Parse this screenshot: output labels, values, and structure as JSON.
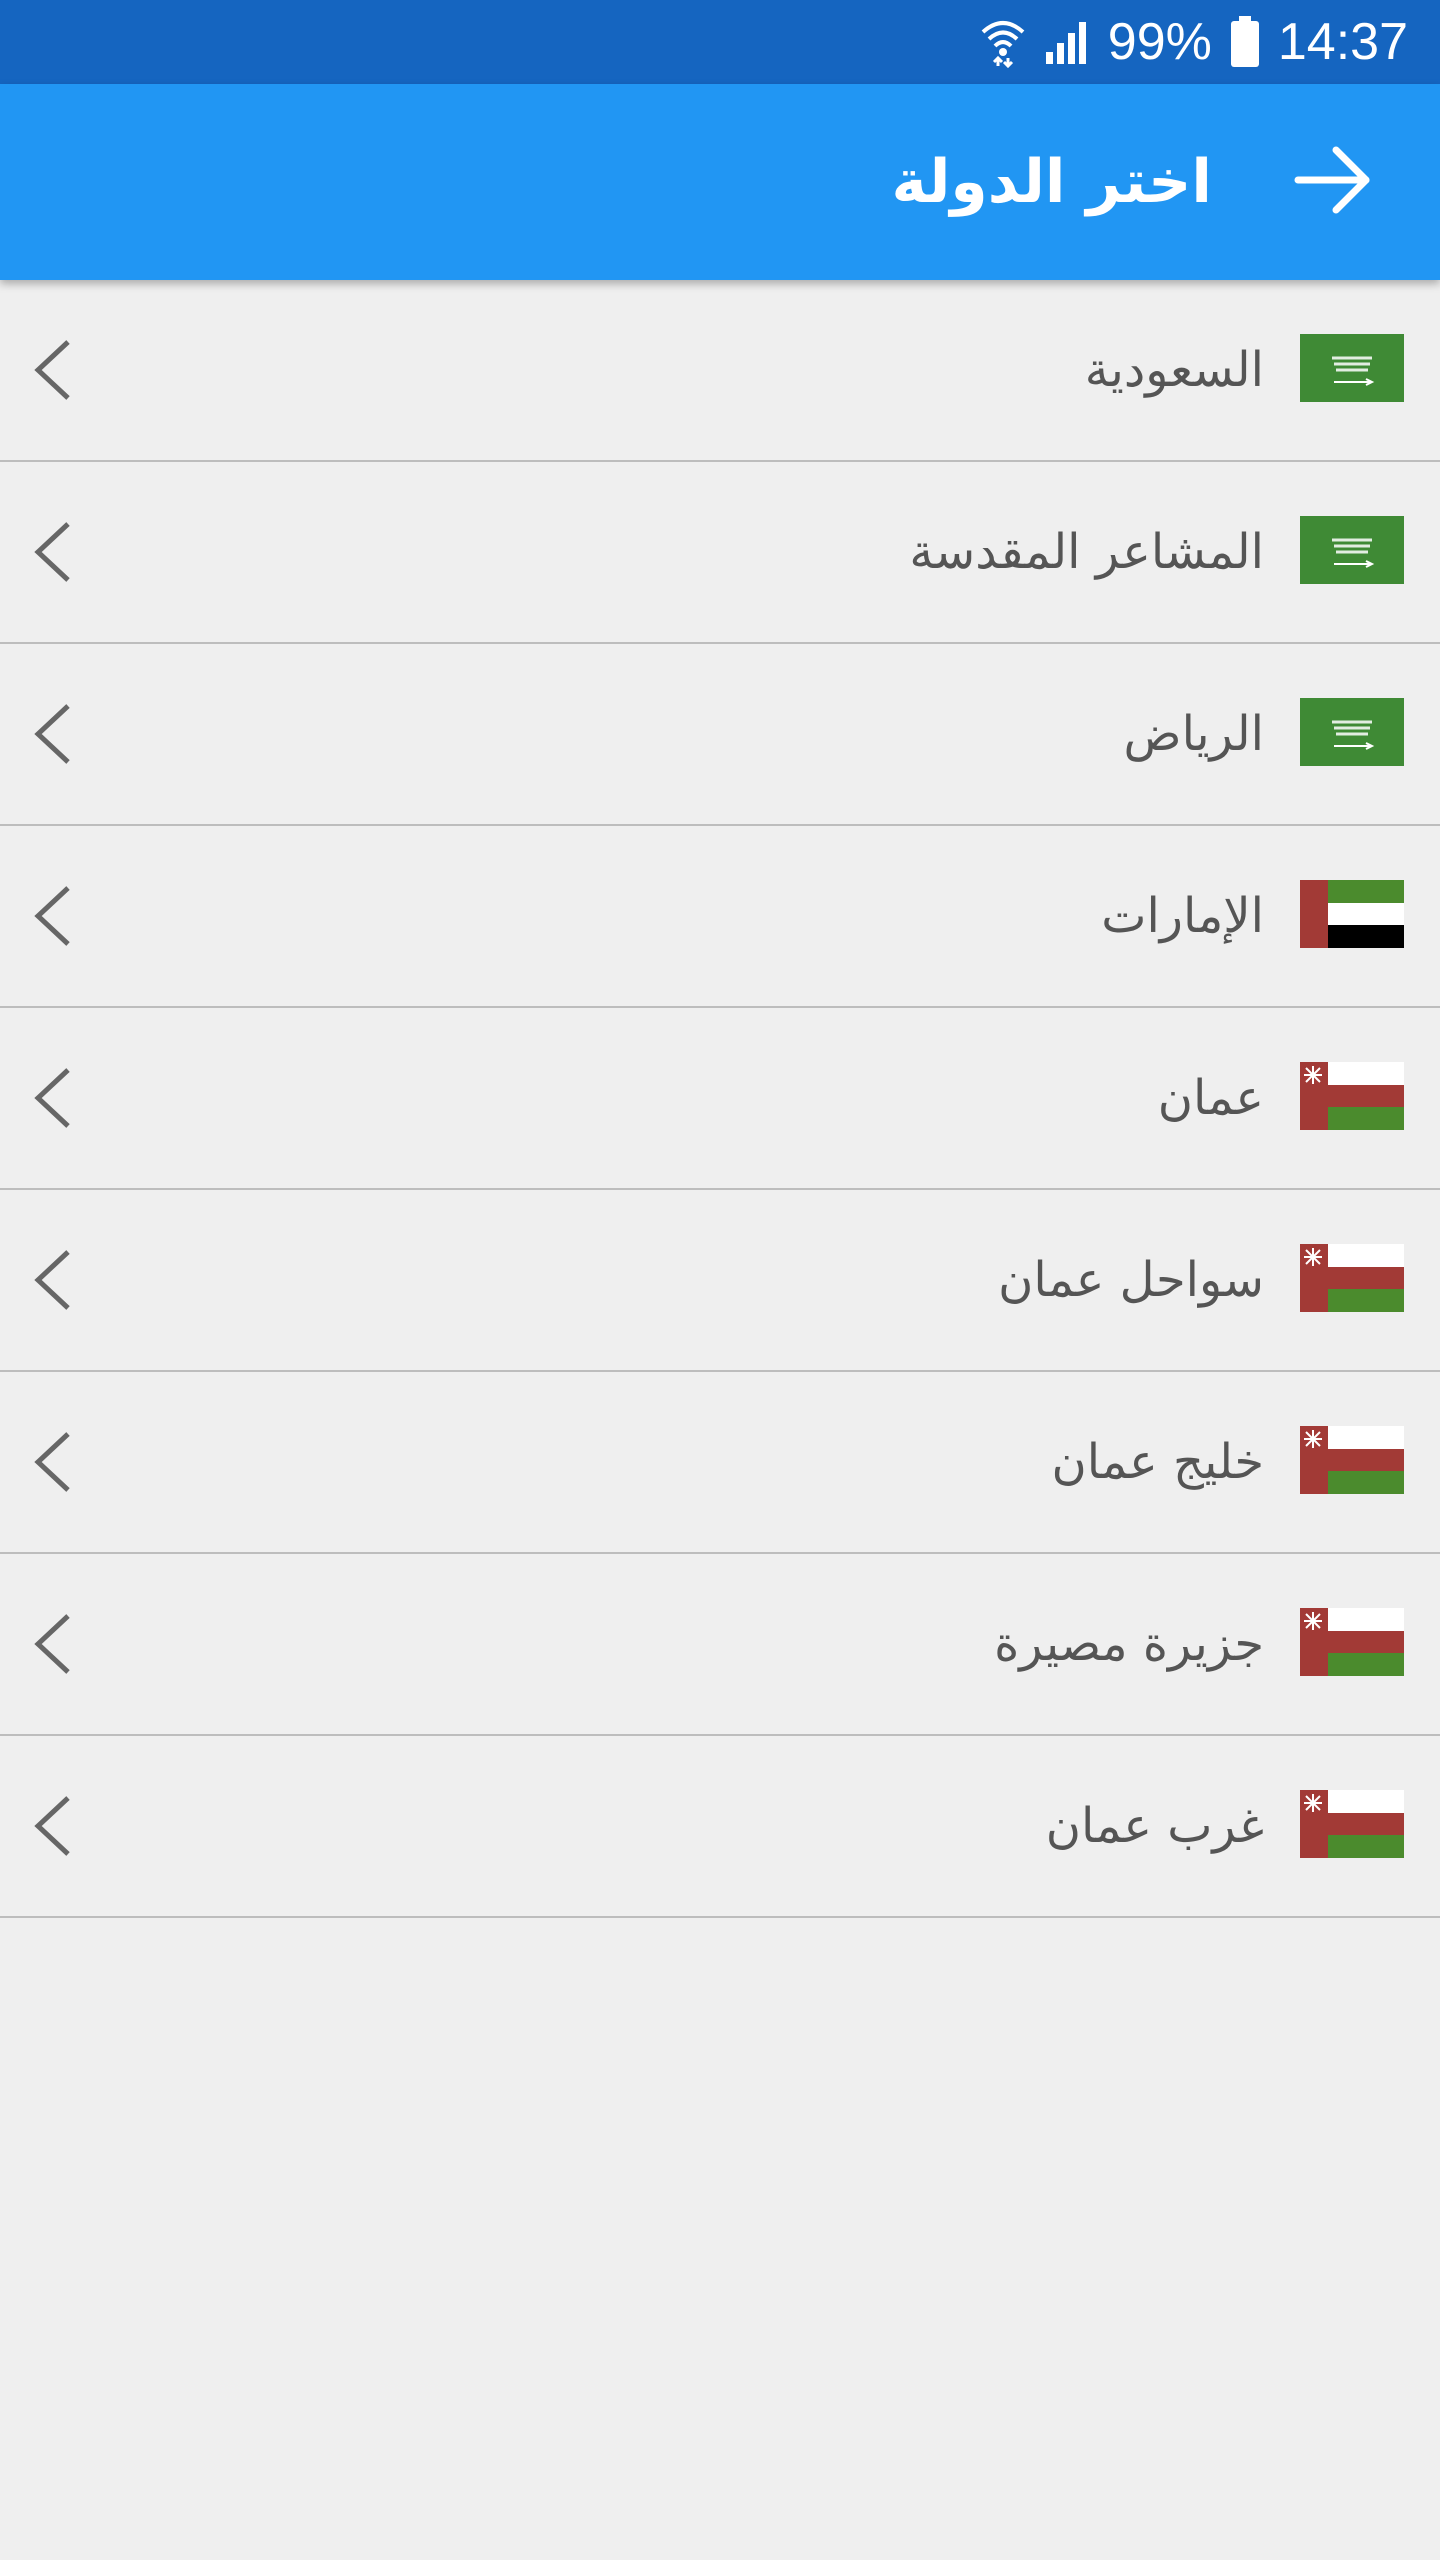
{
  "status_bar": {
    "battery_text": "99%",
    "time": "14:37",
    "icons": [
      "wifi-icon",
      "signal-icon",
      "battery-icon"
    ]
  },
  "app_bar": {
    "title": "اختر الدولة",
    "back_icon": "arrow-forward-icon",
    "color": "#2196f3"
  },
  "colors": {
    "status_bar": "#1565c0",
    "saudi_green": "#3f8a35",
    "red": "#a23a36",
    "green": "#4b8b2d"
  },
  "items": [
    {
      "label": "السعودية",
      "flag": "saudi-flag"
    },
    {
      "label": "المشاعر المقدسة",
      "flag": "saudi-flag"
    },
    {
      "label": "الرياض",
      "flag": "saudi-flag"
    },
    {
      "label": "الإمارات",
      "flag": "uae-flag"
    },
    {
      "label": "عمان",
      "flag": "oman-flag"
    },
    {
      "label": "سواحل عمان",
      "flag": "oman-flag"
    },
    {
      "label": "خليج عمان",
      "flag": "oman-flag"
    },
    {
      "label": "جزيرة مصيرة",
      "flag": "oman-flag"
    },
    {
      "label": "غرب عمان",
      "flag": "oman-flag"
    }
  ]
}
